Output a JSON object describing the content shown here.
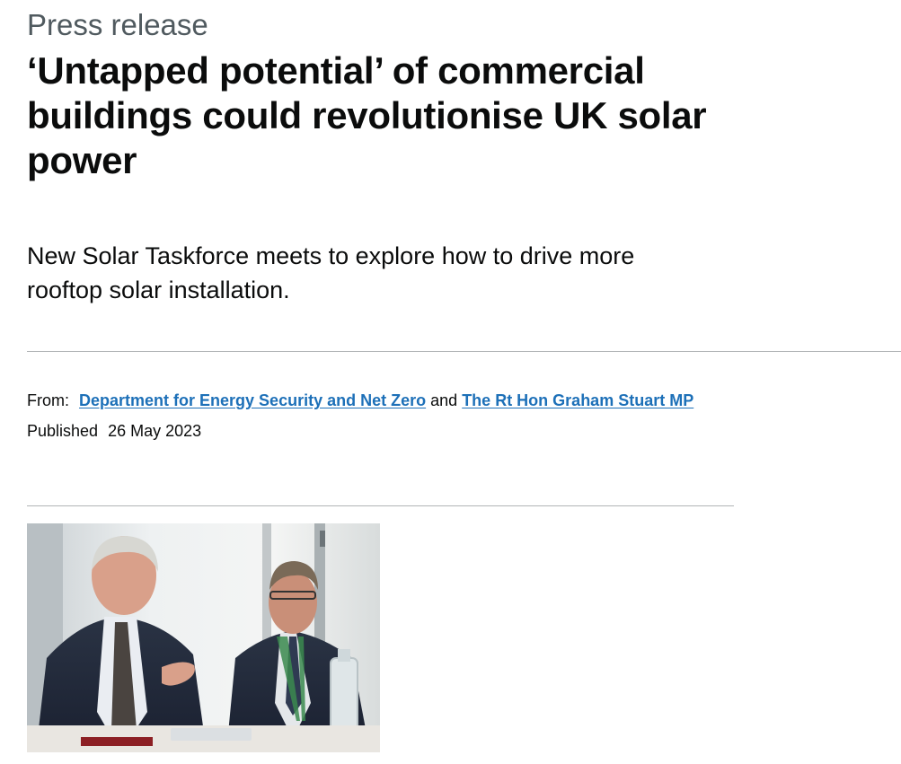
{
  "header": {
    "caption": "Press release",
    "title": "‘Untapped potential’ of commercial buildings could revolutionise UK solar power",
    "lead": "New Solar Taskforce meets to explore how to drive more rooftop solar installation."
  },
  "metadata": {
    "from_label": "From:",
    "from_org_1": "Department for Energy Security and Net Zero",
    "conjunction": "and",
    "from_org_2": "The Rt Hon Graham Stuart MP",
    "published_label": "Published",
    "published_date": "26 May 2023"
  },
  "colors": {
    "text": "#0b0c0c",
    "caption": "#505a5f",
    "link": "#1d70b8",
    "rule": "#b1b4b6"
  },
  "image": {
    "subject": "photo of two men in suits at a meeting table"
  }
}
